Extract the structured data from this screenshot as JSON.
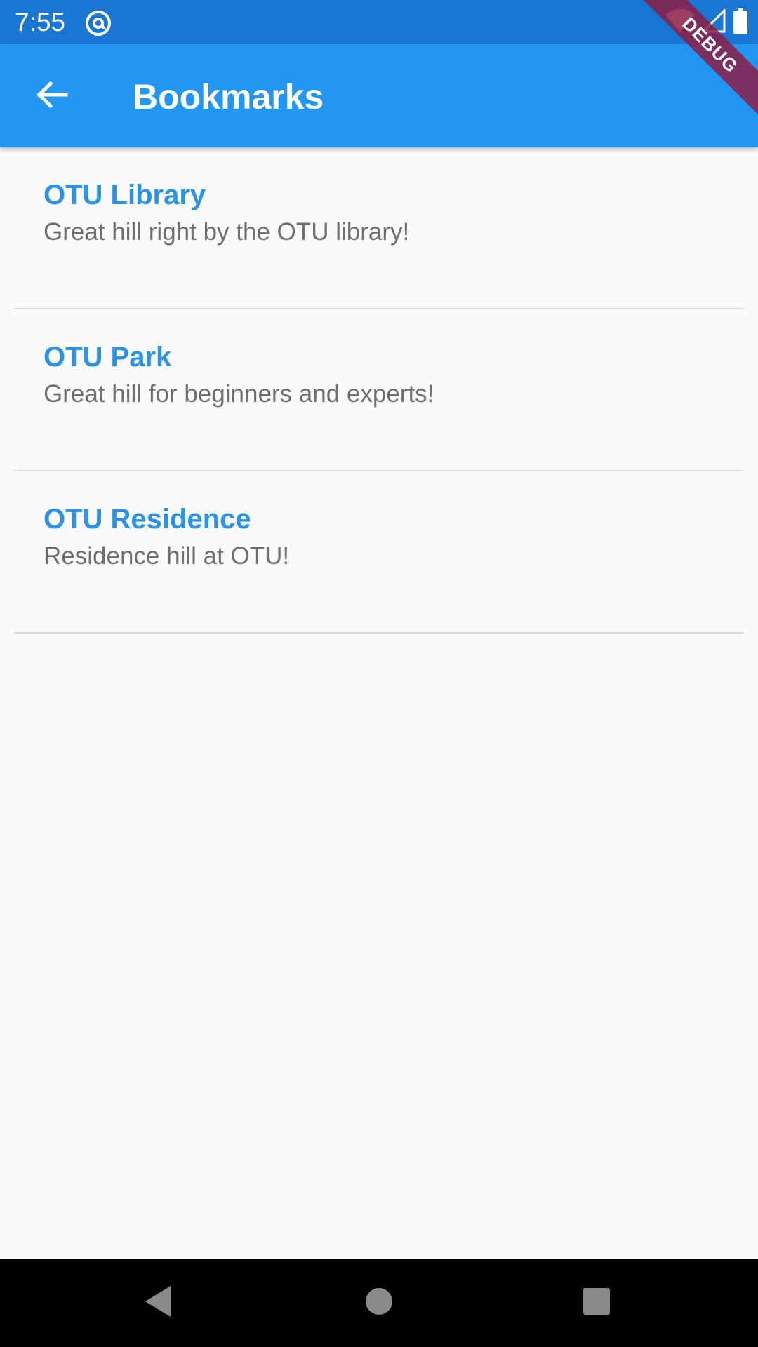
{
  "status_bar": {
    "time": "7:55",
    "app_icon": "at-sign-icon",
    "icons": [
      "wifi-icon",
      "cell-signal-icon",
      "battery-icon"
    ]
  },
  "debug_banner": {
    "label": "DEBUG",
    "color": "#8c1e46"
  },
  "app_bar": {
    "title": "Bookmarks",
    "back_icon": "arrow-back-icon",
    "color": "#2196f3"
  },
  "bookmarks": [
    {
      "title": "OTU Library",
      "subtitle": "Great hill right by the OTU library!"
    },
    {
      "title": "OTU Park",
      "subtitle": "Great hill for beginners and experts!"
    },
    {
      "title": "OTU Residence",
      "subtitle": "Residence hill at OTU!"
    }
  ],
  "colors": {
    "title_text": "#2a93e8",
    "subtitle_text": "#6f6f6f",
    "divider": "#d9d9d9",
    "status_bar": "#1976d2",
    "background": "#fafafa"
  },
  "nav_bar": {
    "icons": [
      "back-triangle-icon",
      "home-circle-icon",
      "recents-square-icon"
    ]
  }
}
